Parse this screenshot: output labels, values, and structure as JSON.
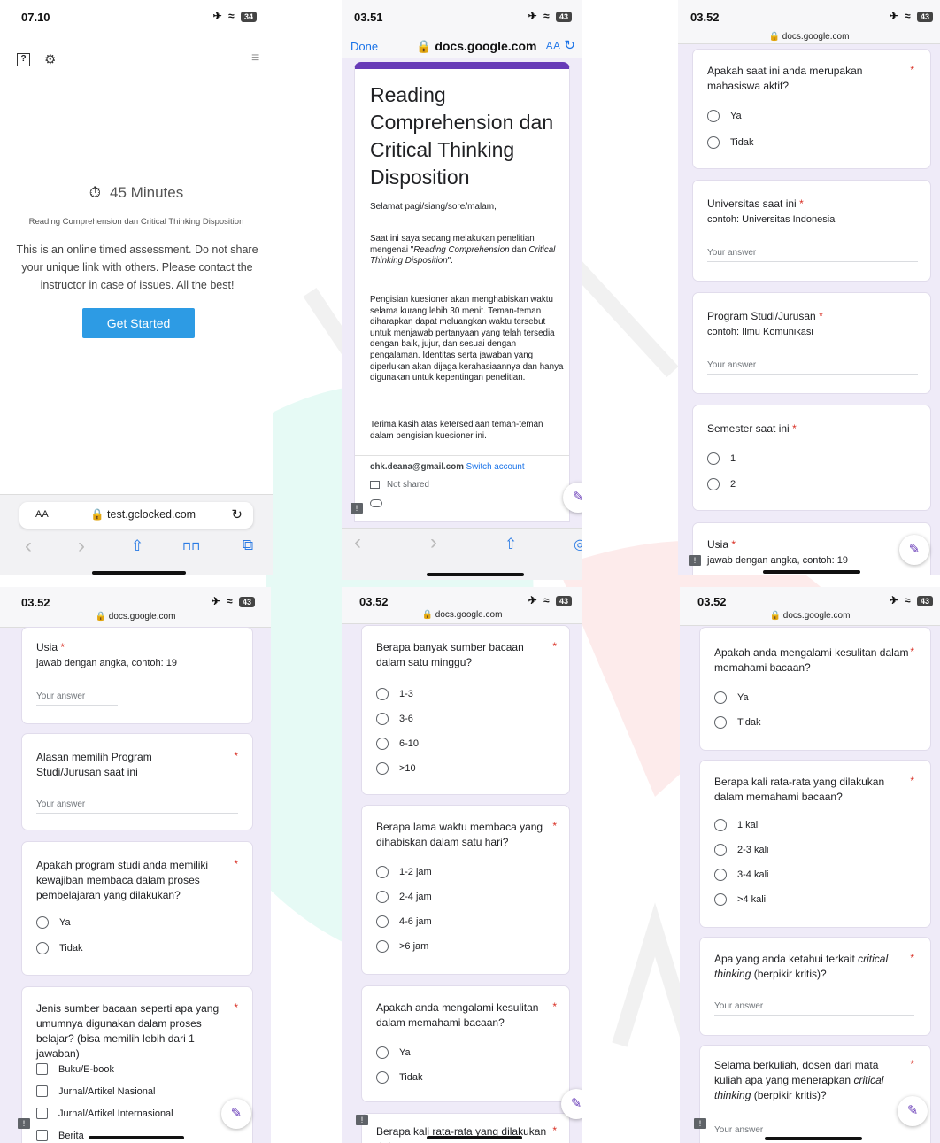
{
  "p1": {
    "time": "07.10",
    "status_icons": "✈ ≈",
    "battery": "34",
    "help_icon": "?",
    "gear_icon": "⚙",
    "menu_icon": "≡",
    "timer_icon": "⏱",
    "duration": "45 Minutes",
    "assessment_title": "Reading Comprehension dan Critical Thinking Disposition",
    "description": "This is an online timed assessment. Do not share your unique link with others. Please contact the instructor in case of issues. All the best!",
    "start_button": "Get Started",
    "aa": "AA",
    "url": "🔒 test.gclocked.com",
    "reload": "↻",
    "nav": {
      "back": "‹",
      "forward": "›",
      "share": "⇧",
      "bookmarks": "⊓⊓",
      "tabs": "⧉"
    }
  },
  "p2": {
    "time": "03.51",
    "status_icons": "✈ ≈",
    "battery": "43",
    "done": "Done",
    "url": "🔒 docs.google.com",
    "aa": "AA",
    "reload": "↻",
    "title": "Reading Comprehension dan Critical Thinking Disposition",
    "greeting": "Selamat pagi/siang/sore/malam,",
    "intro_pre": "Saat ini saya sedang melakukan penelitian mengenai \"",
    "intro_em1": "Reading Comprehension",
    "intro_mid": " dan ",
    "intro_em2": "Critical Thinking Disposition",
    "intro_post": "\".",
    "body": "Pengisian kuesioner akan menghabiskan waktu selama kurang lebih 30 menit. Teman-teman diharapkan dapat meluangkan waktu tersebut untuk menjawab pertanyaan yang telah tersedia dengan baik, jujur, dan sesuai dengan pengalaman. Identitas serta jawaban yang diperlukan akan dijaga kerahasiaannya dan hanya digunakan untuk kepentingan penelitian.",
    "thanks": "Terima kasih atas ketersediaan teman-teman dalam pengisian kuesioner ini.",
    "email": "chk.deana@gmail.com",
    "switch": "Switch account",
    "not_shared": "Not shared",
    "nav": {
      "back": "‹",
      "forward": "›",
      "share": "⇧",
      "compass": "◎"
    }
  },
  "p3": {
    "time": "03.52",
    "status_icons": "✈ ≈",
    "battery": "43",
    "url": "🔒 docs.google.com",
    "q1": "Apakah saat ini anda merupakan mahasiswa aktif?",
    "q1_opts": [
      "Ya",
      "Tidak"
    ],
    "q2": "Universitas saat ini",
    "q2_hint": "contoh: Universitas Indonesia",
    "q3": "Program Studi/Jurusan",
    "q3_hint": "contoh: Ilmu Komunikasi",
    "q4": "Semester saat ini",
    "q4_opts": [
      "1",
      "2"
    ],
    "q5": "Usia",
    "q5_hint": "jawab dengan angka, contoh: 19",
    "your_answer": "Your answer"
  },
  "p4": {
    "time": "03.52",
    "status_icons": "✈ ≈",
    "battery": "43",
    "url": "🔒 docs.google.com",
    "q1": "Usia",
    "q1_hint": "jawab dengan angka, contoh: 19",
    "q2": "Alasan memilih Program Studi/Jurusan saat ini",
    "q3": "Apakah program studi anda memiliki kewajiban membaca dalam proses pembelajaran yang dilakukan?",
    "q3_opts": [
      "Ya",
      "Tidak"
    ],
    "q4": "Jenis sumber bacaan seperti apa yang umumnya digunakan dalam proses belajar? (bisa memilih lebih dari 1 jawaban)",
    "q4_opts": [
      "Buku/E-book",
      "Jurnal/Artikel Nasional",
      "Jurnal/Artikel Internasional",
      "Berita"
    ],
    "your_answer": "Your answer"
  },
  "p5": {
    "time": "03.52",
    "status_icons": "✈ ≈",
    "battery": "43",
    "url": "🔒 docs.google.com",
    "q1": "Berapa banyak sumber bacaan dalam satu minggu?",
    "q1_opts": [
      "1-3",
      "3-6",
      "6-10",
      ">10"
    ],
    "q2": "Berapa lama waktu membaca yang dihabiskan dalam satu hari?",
    "q2_opts": [
      "1-2 jam",
      "2-4 jam",
      "4-6 jam",
      ">6 jam"
    ],
    "q3": "Apakah anda mengalami kesulitan dalam memahami bacaan?",
    "q3_opts": [
      "Ya",
      "Tidak"
    ],
    "q4": "Berapa kali rata-rata yang dilakukan dalam"
  },
  "p6": {
    "time": "03.52",
    "status_icons": "✈ ≈",
    "battery": "43",
    "url": "🔒 docs.google.com",
    "q1": "Apakah anda mengalami kesulitan dalam memahami bacaan?",
    "q1_opts": [
      "Ya",
      "Tidak"
    ],
    "q2": "Berapa kali rata-rata yang dilakukan dalam memahami bacaan?",
    "q2_opts": [
      "1 kali",
      "2-3 kali",
      "3-4 kali",
      ">4 kali"
    ],
    "q3_pre": "Apa yang anda ketahui terkait ",
    "q3_em": "critical thinking",
    "q3_post": " (berpikir kritis)?",
    "q4_pre": "Selama berkuliah, dosen dari mata kuliah apa yang menerapkan ",
    "q4_em": "critical thinking",
    "q4_post": " (berpikir kritis)?",
    "your_answer": "Your answer"
  },
  "common": {
    "required_star": "*",
    "edit_icon": "✎",
    "feedback_icon": "!"
  },
  "colors": {
    "google_forms_purple": "#673ab7",
    "form_background": "#efebf8",
    "required_red": "#d93025",
    "button_blue": "#2d9be4",
    "link_blue": "#1a73e8"
  }
}
